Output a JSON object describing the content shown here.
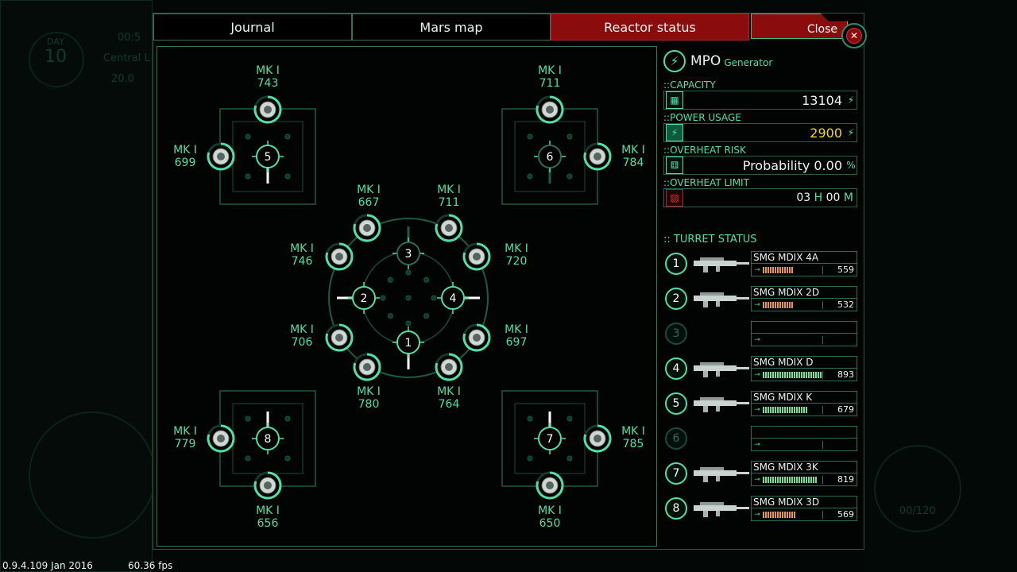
{
  "background": {
    "day_label": "DAY",
    "day_value": "10",
    "time_text": "00:5",
    "location_text": "Central L",
    "temp_text": "20.0",
    "counter_text": "00/120"
  },
  "tabs": [
    {
      "label": "Journal",
      "active": false
    },
    {
      "label": "Mars map",
      "active": false
    },
    {
      "label": "Reactor status",
      "active": true
    }
  ],
  "close_label": "Close",
  "close_x": "✕",
  "hub_numbers": [
    "1",
    "2",
    "3",
    "4",
    "5",
    "6",
    "7",
    "8"
  ],
  "emplacements": [
    {
      "mk": "MK I",
      "val": "743"
    },
    {
      "mk": "MK I",
      "val": "699"
    },
    {
      "mk": "MK I",
      "val": "711"
    },
    {
      "mk": "MK I",
      "val": "784"
    },
    {
      "mk": "MK I",
      "val": "667"
    },
    {
      "mk": "MK I",
      "val": "711"
    },
    {
      "mk": "MK I",
      "val": "746"
    },
    {
      "mk": "MK I",
      "val": "720"
    },
    {
      "mk": "MK I",
      "val": "706"
    },
    {
      "mk": "MK I",
      "val": "697"
    },
    {
      "mk": "MK I",
      "val": "780"
    },
    {
      "mk": "MK I",
      "val": "764"
    },
    {
      "mk": "MK I",
      "val": "779"
    },
    {
      "mk": "MK I",
      "val": "656"
    },
    {
      "mk": "MK I",
      "val": "785"
    },
    {
      "mk": "MK I",
      "val": "650"
    }
  ],
  "generator": {
    "icon": "lightning-icon",
    "title": "MPO",
    "subtitle": "Generator",
    "capacity_label": "::CAPACITY",
    "capacity_value": "13104",
    "power_label": "::POWER USAGE",
    "power_value": "2900",
    "risk_label": "::OVERHEAT RISK",
    "risk_value": "Probability 0.00",
    "risk_unit": "%",
    "limit_label": "::OVERHEAT LIMIT",
    "limit_hours": "03",
    "limit_h": "H",
    "limit_minutes": "00",
    "limit_m": "M",
    "bolt": "⚡"
  },
  "turret_status_title": ":: TURRET STATUS",
  "turrets": [
    {
      "num": "1",
      "name": "SMG MDIX 4A",
      "ammo": "559",
      "fill": 0.5,
      "color": "#e8963a"
    },
    {
      "num": "2",
      "name": "SMG MDIX 2D",
      "ammo": "532",
      "fill": 0.5,
      "color": "#e8963a"
    },
    {
      "num": "3",
      "name": "",
      "ammo": "",
      "fill": 0,
      "color": "#e8963a"
    },
    {
      "num": "4",
      "name": "SMG MDIX D",
      "ammo": "893",
      "fill": 1.0,
      "color": "#6fe09a"
    },
    {
      "num": "5",
      "name": "SMG MDIX K",
      "ammo": "679",
      "fill": 0.75,
      "color": "#6fe09a"
    },
    {
      "num": "6",
      "name": "",
      "ammo": "",
      "fill": 0,
      "color": "#e8963a"
    },
    {
      "num": "7",
      "name": "SMG MDIX 3K",
      "ammo": "819",
      "fill": 0.9,
      "color": "#6fe09a"
    },
    {
      "num": "8",
      "name": "SMG MDIX 3D",
      "ammo": "569",
      "fill": 0.55,
      "color": "#e8963a"
    }
  ],
  "footer": {
    "version": "0.9.4.109 Jan 2016",
    "fps": "60.36 fps"
  }
}
